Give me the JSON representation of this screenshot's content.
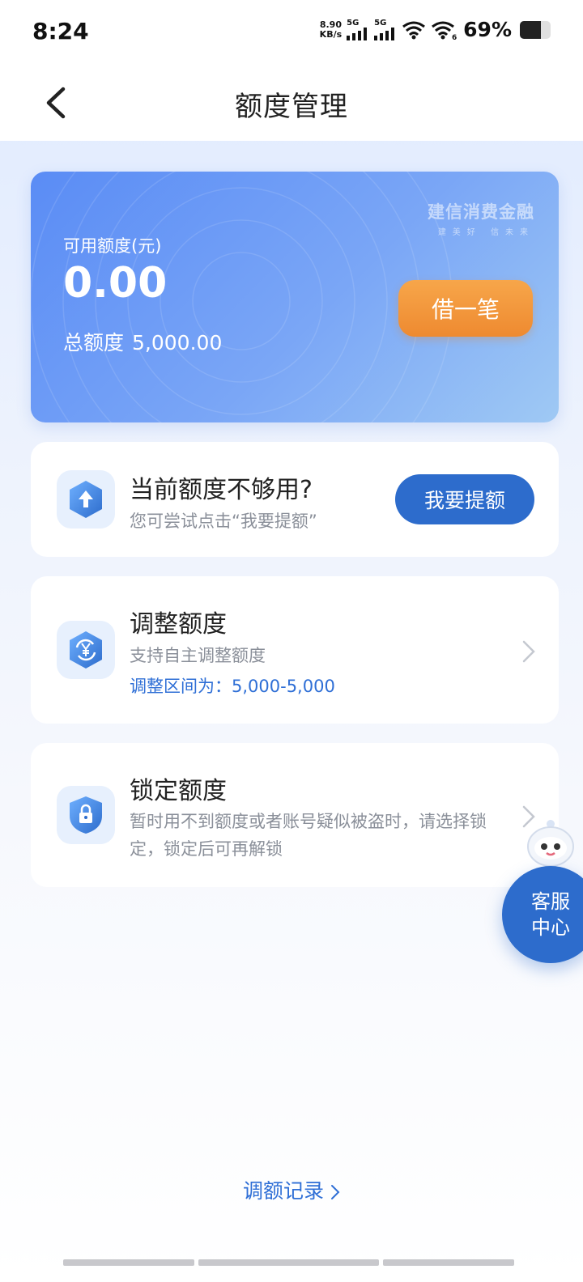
{
  "status_bar": {
    "time": "8:24",
    "net_speed_value": "8.90",
    "net_speed_unit": "KB/s",
    "signal_1_label": "5G",
    "signal_2_label": "5G",
    "battery_percent_text": "69%",
    "battery_level": 0.69
  },
  "header": {
    "title": "额度管理"
  },
  "credit_card": {
    "brand_name": "建信消费金融",
    "brand_slogan": "建美好 信未来",
    "available_label": "可用额度(元)",
    "available_value": "0.00",
    "total_label": "总额度",
    "total_value": "5,000.00",
    "borrow_button": "借一笔"
  },
  "raise_panel": {
    "title": "当前额度不够用?",
    "subtitle": "您可尝试点击“我要提额”",
    "button": "我要提额"
  },
  "adjust_panel": {
    "title": "调整额度",
    "subtitle": "支持自主调整额度",
    "range_text": "调整区间为：5,000-5,000"
  },
  "lock_panel": {
    "title": "锁定额度",
    "description": "暂时用不到额度或者账号疑似被盗时，请选择锁定，锁定后可再解锁"
  },
  "customer_service": {
    "label": "客服中心"
  },
  "footer": {
    "records_link": "调额记录"
  },
  "colors": {
    "accent_blue": "#2d6ccc",
    "link_blue": "#2f6fd6",
    "borrow_orange": "#ee8a30"
  },
  "icons": {
    "back": "back-arrow-icon",
    "raise": "up-arrow-hexagon-icon",
    "adjust": "yen-refresh-hexagon-icon",
    "lock": "lock-shield-icon",
    "chevron": "chevron-right-icon"
  }
}
